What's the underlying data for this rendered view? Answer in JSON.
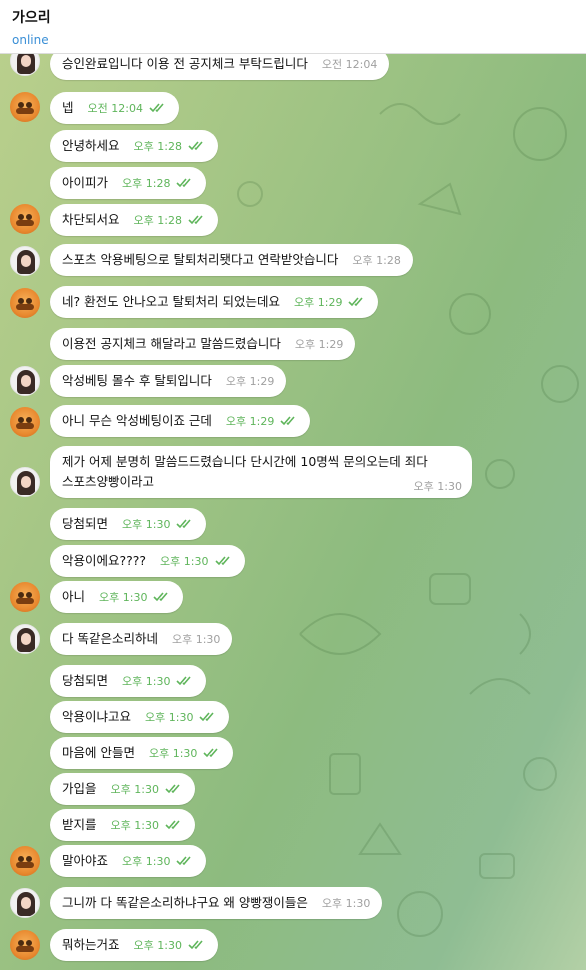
{
  "header": {
    "title": "가으리",
    "status": "online"
  },
  "messages": [
    {
      "text": "승인완료입니다 이용 전 공지체크 부탁드립니다",
      "time": "오전 12:04"
    },
    {
      "text": "넵",
      "time": "오전 12:04"
    },
    {
      "text": "안녕하세요",
      "time": "오후 1:28"
    },
    {
      "text": "아이피가",
      "time": "오후 1:28"
    },
    {
      "text": "차단되서요",
      "time": "오후 1:28"
    },
    {
      "text": "스포츠 악용베팅으로 탈퇴처리됏다고 연락받앗습니다",
      "time": "오후 1:28"
    },
    {
      "text": "네? 환전도 안나오고 탈퇴처리 되었는데요",
      "time": "오후 1:29"
    },
    {
      "text": "이용전 공지체크 해달라고 말씀드렸습니다",
      "time": "오후 1:29"
    },
    {
      "text": "악성베팅 몰수 후 탈퇴입니다",
      "time": "오후 1:29"
    },
    {
      "text": "아니 무슨 악성베팅이죠 근데",
      "time": "오후 1:29"
    },
    {
      "text": "제가 어제 분명히 말씀드드렸습니다 단시간에 10명씩 문의오는데 죄다",
      "text2": "스포츠양빵이라고",
      "time": "오후 1:30"
    },
    {
      "text": "당첨되면",
      "time": "오후 1:30"
    },
    {
      "text": "악용이에요????",
      "time": "오후 1:30"
    },
    {
      "text": "아니",
      "time": "오후 1:30"
    },
    {
      "text": "다 똑같은소리하네",
      "time": "오후 1:30"
    },
    {
      "text": "당첨되면",
      "time": "오후 1:30"
    },
    {
      "text": "악용이냐고요",
      "time": "오후 1:30"
    },
    {
      "text": "마음에 안들면",
      "time": "오후 1:30"
    },
    {
      "text": "가입을",
      "time": "오후 1:30"
    },
    {
      "text": "받지를",
      "time": "오후 1:30"
    },
    {
      "text": "말아야죠",
      "time": "오후 1:30"
    },
    {
      "text": "그니까 다 똑같은소리하냐구요 왜 양빵쟁이들은",
      "time": "오후 1:30"
    },
    {
      "text": "뭐하는거죠",
      "time": "오후 1:30"
    }
  ],
  "colors": {
    "accent": "#3a8fd6",
    "read_check": "#5fb55b",
    "bubble": "#ffffff"
  },
  "icons": {
    "read": "double-check-icon"
  }
}
